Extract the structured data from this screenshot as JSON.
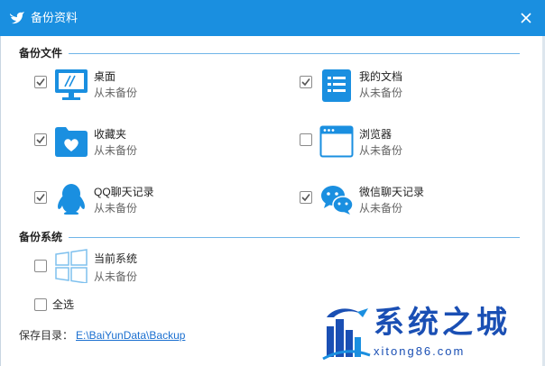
{
  "window": {
    "title": "备份资料",
    "accent": "#1a8fe0"
  },
  "sections": {
    "files": {
      "title": "备份文件"
    },
    "system": {
      "title": "备份系统"
    }
  },
  "items": [
    {
      "name": "桌面",
      "status": "从未备份",
      "checked": true,
      "icon": "desktop-icon"
    },
    {
      "name": "我的文档",
      "status": "从未备份",
      "checked": true,
      "icon": "document-icon"
    },
    {
      "name": "收藏夹",
      "status": "从未备份",
      "checked": true,
      "icon": "favorites-folder-icon"
    },
    {
      "name": "浏览器",
      "status": "从未备份",
      "checked": false,
      "icon": "browser-window-icon"
    },
    {
      "name": "QQ聊天记录",
      "status": "从未备份",
      "checked": true,
      "icon": "qq-icon"
    },
    {
      "name": "微信聊天记录",
      "status": "从未备份",
      "checked": true,
      "icon": "wechat-icon"
    }
  ],
  "system_item": {
    "name": "当前系统",
    "status": "从未备份",
    "checked": false,
    "icon": "windows-icon"
  },
  "select_all": {
    "label": "全选",
    "checked": false
  },
  "save_path": {
    "label": "保存目录：",
    "value": "E:\\BaiYunData\\Backup"
  },
  "watermark": {
    "text": "系统之城",
    "url": "xitong86.com"
  }
}
